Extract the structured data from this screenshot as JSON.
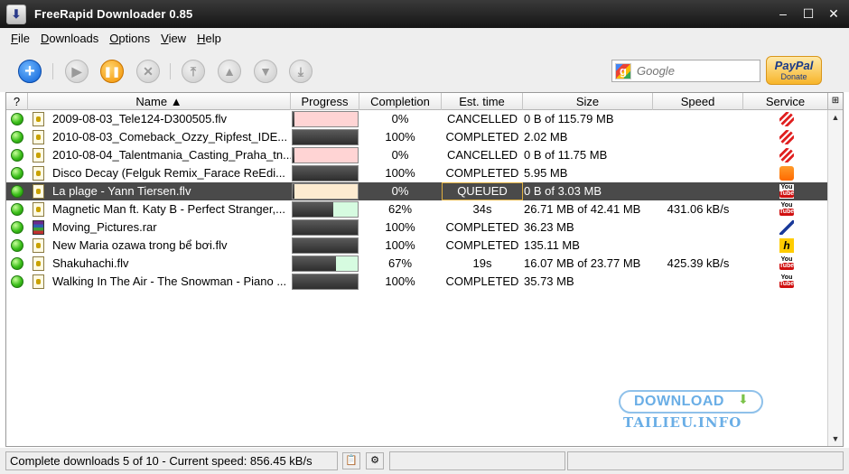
{
  "window": {
    "title": "FreeRapid Downloader 0.85"
  },
  "menu": [
    "File",
    "Downloads",
    "Options",
    "View",
    "Help"
  ],
  "search": {
    "placeholder": "Google"
  },
  "paypal": {
    "logo": "PayPal",
    "label": "Donate"
  },
  "columns": {
    "status": "?",
    "name": "Name ▲",
    "progress": "Progress",
    "completion": "Completion",
    "est": "Est. time",
    "size": "Size",
    "speed": "Speed",
    "service": "Service"
  },
  "downloads": [
    {
      "name": "2009-08-03_Tele124-D300505.flv",
      "progress": 0.0,
      "bar": "#ffd4d4",
      "completion": "0%",
      "est": "CANCELLED",
      "size": "0 B of 115.79 MB",
      "speed": "",
      "file_icon": "video",
      "service": "red-striped"
    },
    {
      "name": "2010-08-03_Comeback_Ozzy_Ripfest_IDE...",
      "progress": 1.0,
      "bar": "#ffd4d4",
      "completion": "100%",
      "est": "COMPLETED",
      "size": "2.02 MB",
      "speed": "",
      "file_icon": "video",
      "service": "red-striped"
    },
    {
      "name": "2010-08-04_Talentmania_Casting_Praha_tn...",
      "progress": 0.0,
      "bar": "#ffd4d4",
      "completion": "0%",
      "est": "CANCELLED",
      "size": "0 B of 11.75 MB",
      "speed": "",
      "file_icon": "video",
      "service": "red-striped"
    },
    {
      "name": "Disco Decay (Felguk Remix_Farace ReEdi...",
      "progress": 1.0,
      "bar": "#ffd4d4",
      "completion": "100%",
      "est": "COMPLETED",
      "size": "5.95 MB",
      "speed": "",
      "file_icon": "video",
      "service": "soundcloud"
    },
    {
      "name": "La plage - Yann Tiersen.flv",
      "progress": 0.0,
      "bar": "#fdebd0",
      "completion": "0%",
      "est": "QUEUED",
      "size": "0 B of 3.03 MB",
      "speed": "",
      "file_icon": "video",
      "service": "youtube",
      "selected": true
    },
    {
      "name": "Magnetic Man ft. Katy B - Perfect Stranger,...",
      "progress": 0.62,
      "bar": "#d6fbe0",
      "completion": "62%",
      "est": "34s",
      "size": "26.71 MB of 42.41 MB",
      "speed": "431.06 kB/s",
      "file_icon": "video",
      "service": "youtube"
    },
    {
      "name": "Moving_Pictures.rar",
      "progress": 1.0,
      "bar": "#ffffff",
      "completion": "100%",
      "est": "COMPLETED",
      "size": "36.23 MB",
      "speed": "",
      "file_icon": "rar",
      "service": "hoster"
    },
    {
      "name": "New Maria ozawa trong bể bơi.flv",
      "progress": 1.0,
      "bar": "#ffffff",
      "completion": "100%",
      "est": "COMPLETED",
      "size": "135.11 MB",
      "speed": "",
      "file_icon": "video",
      "service": "h"
    },
    {
      "name": "Shakuhachi.flv",
      "progress": 0.67,
      "bar": "#d6fbe0",
      "completion": "67%",
      "est": "19s",
      "size": "16.07 MB of 23.77 MB",
      "speed": "425.39 kB/s",
      "file_icon": "video",
      "service": "youtube"
    },
    {
      "name": "Walking In The Air - The Snowman - Piano ...",
      "progress": 1.0,
      "bar": "#ffffff",
      "completion": "100%",
      "est": "COMPLETED",
      "size": "35.73 MB",
      "speed": "",
      "file_icon": "video",
      "service": "youtube"
    }
  ],
  "watermark": {
    "top": "DOWNLOAD",
    "bottom": "TAILIEU.INFO"
  },
  "status": {
    "text": "Complete downloads 5 of 10 - Current speed: 856.45 kB/s"
  },
  "yt_top": "You",
  "yt_bottom": "Tube",
  "h_letter": "h"
}
